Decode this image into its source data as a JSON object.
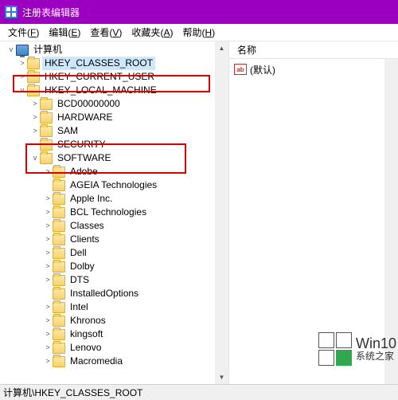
{
  "title": "注册表编辑器",
  "menu": {
    "file": {
      "label": "文件",
      "hotkey": "F"
    },
    "edit": {
      "label": "编辑",
      "hotkey": "E"
    },
    "view": {
      "label": "查看",
      "hotkey": "V"
    },
    "fav": {
      "label": "收藏夹",
      "hotkey": "A"
    },
    "help": {
      "label": "帮助",
      "hotkey": "H"
    }
  },
  "tree": {
    "root": "计算机",
    "root_expanded": true,
    "hives": [
      {
        "name": "HKEY_CLASSES_ROOT",
        "selected": true,
        "expander": ">"
      },
      {
        "name": "HKEY_CURRENT_USER",
        "expander": ">"
      },
      {
        "name": "HKEY_LOCAL_MACHINE",
        "expander": "v",
        "expanded": true,
        "children": [
          {
            "name": "BCD00000000",
            "expander": ">"
          },
          {
            "name": "HARDWARE",
            "expander": ">"
          },
          {
            "name": "SAM",
            "expander": ">"
          },
          {
            "name": "SECURITY",
            "expander": ""
          },
          {
            "name": "SOFTWARE",
            "expander": "v",
            "expanded": true,
            "children": [
              {
                "name": "Adobe",
                "expander": ">"
              },
              {
                "name": "AGEIA Technologies",
                "expander": ""
              },
              {
                "name": "Apple Inc.",
                "expander": ">"
              },
              {
                "name": "BCL Technologies",
                "expander": ">"
              },
              {
                "name": "Classes",
                "expander": ">"
              },
              {
                "name": "Clients",
                "expander": ">"
              },
              {
                "name": "Dell",
                "expander": ">"
              },
              {
                "name": "Dolby",
                "expander": ">"
              },
              {
                "name": "DTS",
                "expander": ">"
              },
              {
                "name": "InstalledOptions",
                "expander": ""
              },
              {
                "name": "Intel",
                "expander": ">"
              },
              {
                "name": "Khronos",
                "expander": ">"
              },
              {
                "name": "kingsoft",
                "expander": ">"
              },
              {
                "name": "Lenovo",
                "expander": ">"
              },
              {
                "name": "Macromedia",
                "expander": ">"
              }
            ]
          }
        ]
      }
    ]
  },
  "list": {
    "header_name": "名称",
    "rows": [
      {
        "icon": "ab",
        "name": "(默认)"
      }
    ]
  },
  "statusbar": "计算机\\HKEY_CLASSES_ROOT",
  "watermark": {
    "line1": "Win10",
    "line2": "系统之家"
  }
}
